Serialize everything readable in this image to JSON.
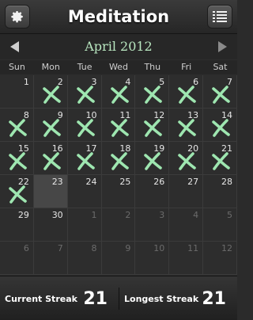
{
  "header": {
    "title": "Meditation",
    "settings_icon": "gear-icon",
    "menu_icon": "list-icon"
  },
  "calendar": {
    "month_label": "April 2012",
    "prev_icon": "chevron-left-icon",
    "next_icon": "chevron-right-icon",
    "weekdays": [
      "Sun",
      "Mon",
      "Tue",
      "Wed",
      "Thu",
      "Fri",
      "Sat"
    ],
    "weeks": [
      [
        {
          "day": "1"
        },
        {
          "day": "2",
          "marked": true
        },
        {
          "day": "3",
          "marked": true
        },
        {
          "day": "4",
          "marked": true
        },
        {
          "day": "5",
          "marked": true
        },
        {
          "day": "6",
          "marked": true
        },
        {
          "day": "7",
          "marked": true
        }
      ],
      [
        {
          "day": "8",
          "marked": true
        },
        {
          "day": "9",
          "marked": true
        },
        {
          "day": "10",
          "marked": true
        },
        {
          "day": "11",
          "marked": true
        },
        {
          "day": "12",
          "marked": true
        },
        {
          "day": "13",
          "marked": true
        },
        {
          "day": "14",
          "marked": true
        }
      ],
      [
        {
          "day": "15",
          "marked": true
        },
        {
          "day": "16",
          "marked": true
        },
        {
          "day": "17",
          "marked": true
        },
        {
          "day": "18",
          "marked": true
        },
        {
          "day": "19",
          "marked": true
        },
        {
          "day": "20",
          "marked": true
        },
        {
          "day": "21",
          "marked": true
        }
      ],
      [
        {
          "day": "22",
          "marked": true
        },
        {
          "day": "23",
          "today": true
        },
        {
          "day": "24"
        },
        {
          "day": "25"
        },
        {
          "day": "26"
        },
        {
          "day": "27"
        },
        {
          "day": "28"
        }
      ],
      [
        {
          "day": "29"
        },
        {
          "day": "30"
        },
        {
          "day": "1",
          "other": true
        },
        {
          "day": "2",
          "other": true
        },
        {
          "day": "3",
          "other": true
        },
        {
          "day": "4",
          "other": true
        },
        {
          "day": "5",
          "other": true
        }
      ],
      [
        {
          "day": "6",
          "other": true
        },
        {
          "day": "7",
          "other": true
        },
        {
          "day": "8",
          "other": true
        },
        {
          "day": "9",
          "other": true
        },
        {
          "day": "10",
          "other": true
        },
        {
          "day": "11",
          "other": true
        },
        {
          "day": "12",
          "other": true
        }
      ]
    ]
  },
  "footer": {
    "current_label": "Current Streak",
    "current_value": "21",
    "longest_label": "Longest Streak",
    "longest_value": "21"
  },
  "colors": {
    "mark": "#9ee6b0",
    "month_text": "#b9e7c0"
  }
}
